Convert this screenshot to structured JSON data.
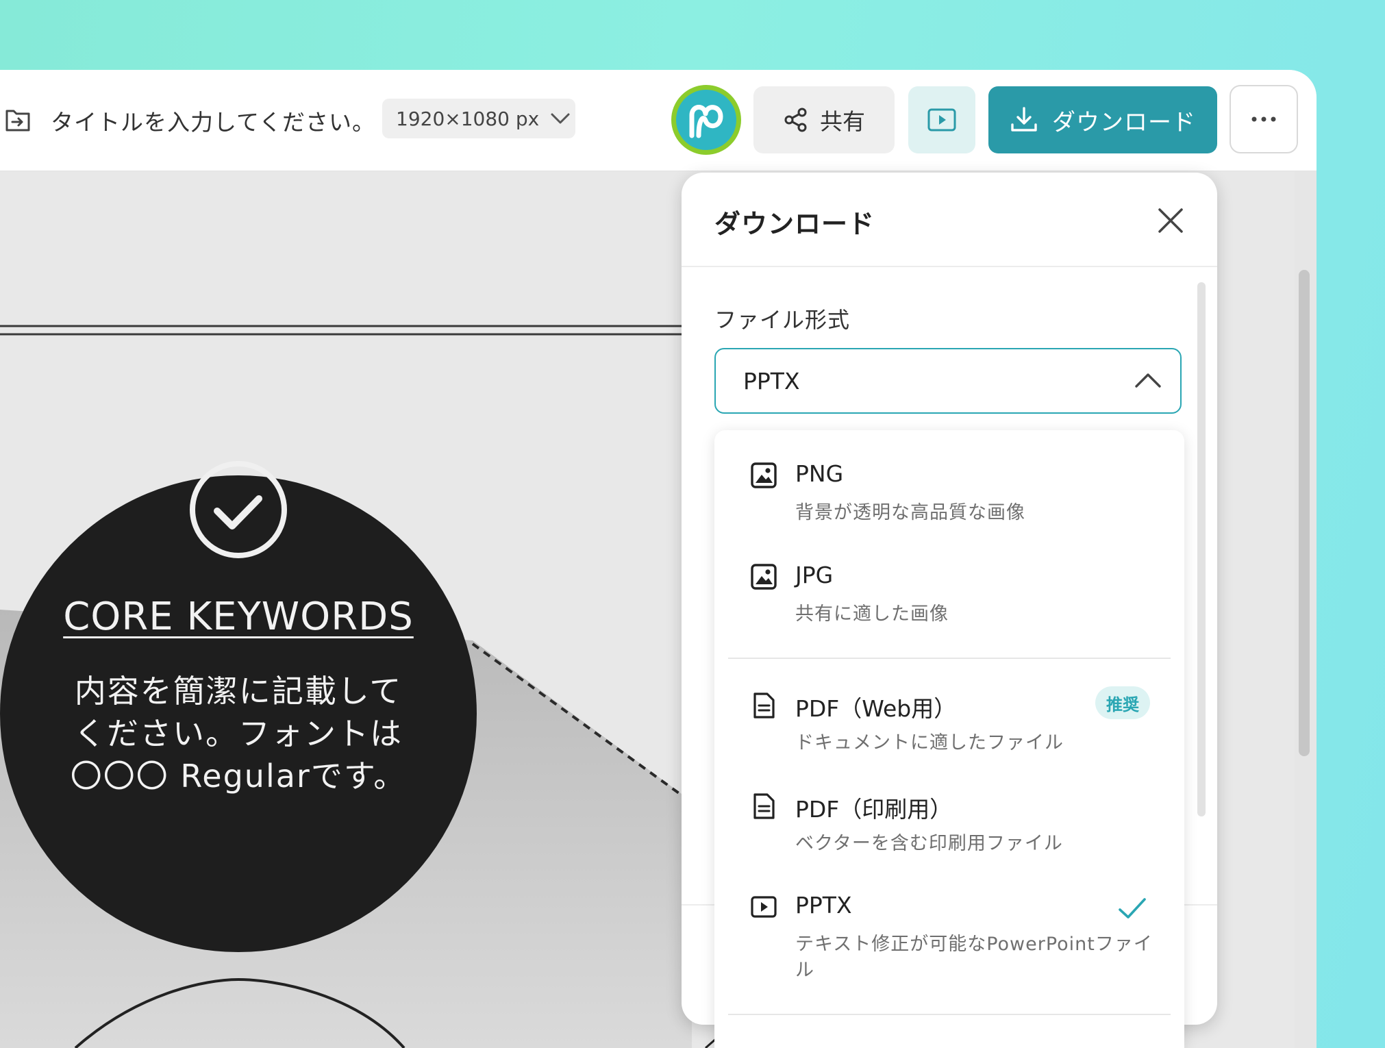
{
  "header": {
    "title": "タイトルを入力してください。",
    "size": "1920×1080 px",
    "share_label": "共有",
    "download_label": "ダウンロード"
  },
  "canvas": {
    "keywords_title": "CORE KEYWORDS",
    "keywords_body": "内容を簡潔に記載してください。フォントは〇〇〇 Regularです。"
  },
  "download_panel": {
    "title": "ダウンロード",
    "format_label": "ファイル形式",
    "selected_format": "PPTX",
    "options": [
      {
        "label": "PNG",
        "description": "背景が透明な高品質な画像",
        "icon": "image-icon"
      },
      {
        "label": "JPG",
        "description": "共有に適した画像",
        "icon": "image-icon"
      },
      {
        "label": "PDF（Web用）",
        "description": "ドキュメントに適したファイル",
        "icon": "document-icon",
        "badge": "推奨"
      },
      {
        "label": "PDF（印刷用）",
        "description": "ベクターを含む印刷用ファイル",
        "icon": "document-icon"
      },
      {
        "label": "PPTX",
        "description": "テキスト修正が可能なPowerPointファイル",
        "icon": "presentation-icon",
        "selected": true
      }
    ]
  },
  "colors": {
    "accent": "#2a9aa8",
    "avatar_ring": "#8ccc2c",
    "background": "#8cefe2"
  }
}
